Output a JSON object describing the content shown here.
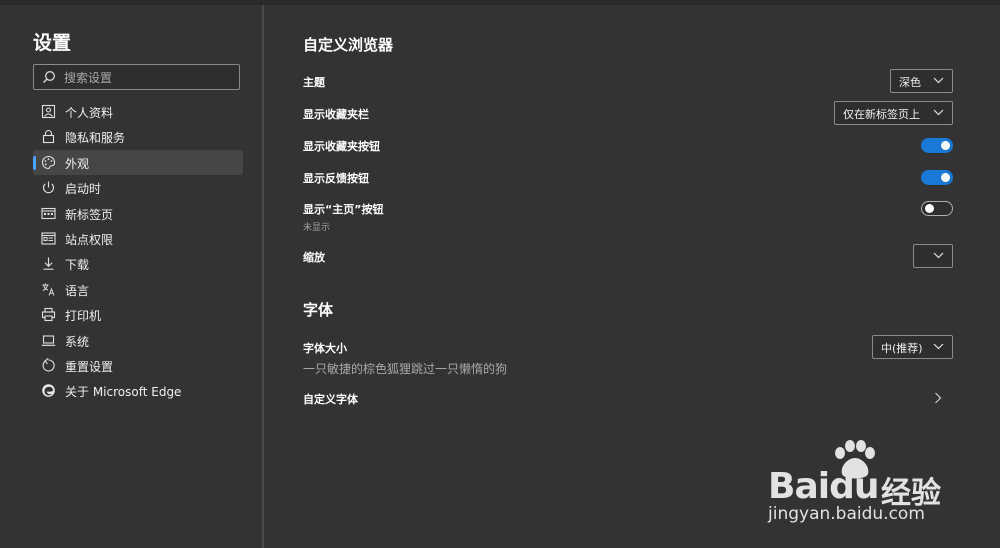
{
  "sidebar": {
    "title": "设置",
    "search_placeholder": "搜索设置",
    "items": [
      {
        "label": "个人资料",
        "icon": "profile-icon"
      },
      {
        "label": "隐私和服务",
        "icon": "lock-icon"
      },
      {
        "label": "外观",
        "icon": "palette-icon",
        "active": true
      },
      {
        "label": "启动时",
        "icon": "power-icon"
      },
      {
        "label": "新标签页",
        "icon": "new-tab-icon"
      },
      {
        "label": "站点权限",
        "icon": "site-permissions-icon"
      },
      {
        "label": "下载",
        "icon": "download-icon"
      },
      {
        "label": "语言",
        "icon": "language-icon"
      },
      {
        "label": "打印机",
        "icon": "printer-icon"
      },
      {
        "label": "系统",
        "icon": "laptop-icon"
      },
      {
        "label": "重置设置",
        "icon": "reset-icon"
      },
      {
        "label": "关于 Microsoft Edge",
        "icon": "edge-logo-icon"
      }
    ]
  },
  "main": {
    "customize": {
      "title": "自定义浏览器",
      "theme": {
        "label": "主题",
        "value": "深色"
      },
      "favorites_bar": {
        "label": "显示收藏夹栏",
        "value": "仅在新标签页上"
      },
      "favorites_button": {
        "label": "显示收藏夹按钮",
        "on": true
      },
      "feedback_button": {
        "label": "显示反馈按钮",
        "on": true
      },
      "home_button": {
        "label": "显示“主页”按钮",
        "sub": "未显示",
        "on": false
      },
      "zoom": {
        "label": "缩放",
        "value": ""
      }
    },
    "fonts": {
      "title": "字体",
      "size": {
        "label": "字体大小",
        "value": "中(推荐)",
        "preview": "一只敏捷的棕色狐狸跳过一只懒惰的狗"
      },
      "custom": {
        "label": "自定义字体"
      }
    }
  },
  "watermark": {
    "brand": "Bai",
    "brand2": "du",
    "product": "经验",
    "url": "jingyan.baidu.com"
  },
  "colors": {
    "background": "#333333",
    "accent": "#1a78d6",
    "active_indicator": "#4aa3ff"
  }
}
